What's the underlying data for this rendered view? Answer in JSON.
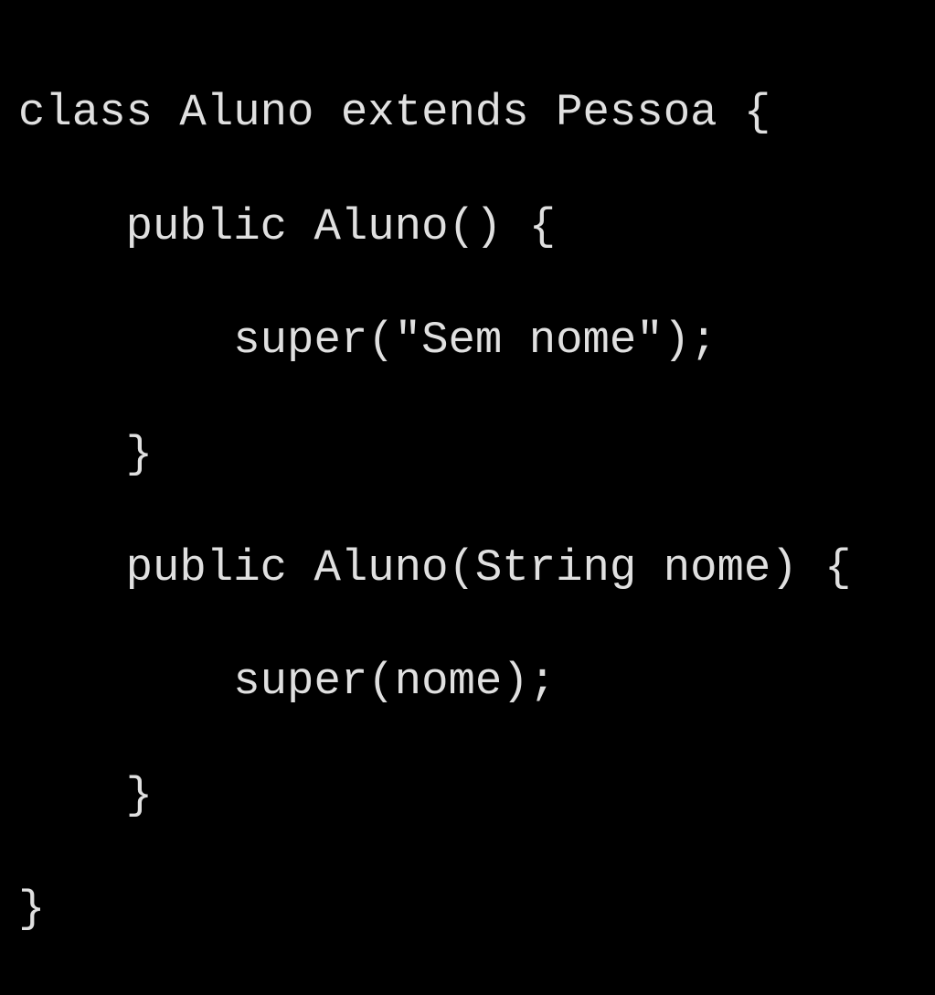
{
  "code": {
    "line1": "class Aluno extends Pessoa {",
    "line2": "    public Aluno() {",
    "line3": "        super(\"Sem nome\");",
    "line4": "    }",
    "line5": "    public Aluno(String nome) {",
    "line6": "        super(nome);",
    "line7": "    }",
    "line8": "}"
  }
}
